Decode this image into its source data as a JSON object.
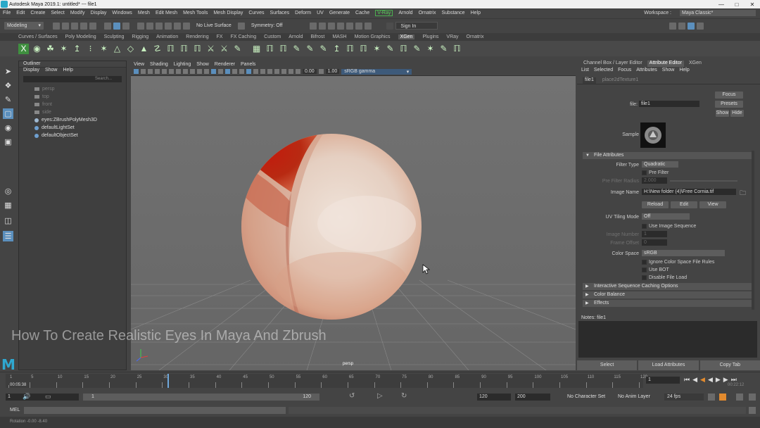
{
  "window": {
    "title": "Autodesk Maya 2019.1: untitled*   ---   file1"
  },
  "menubar": {
    "items": [
      "File",
      "Edit",
      "Create",
      "Select",
      "Modify",
      "Display",
      "Windows",
      "Mesh",
      "Edit Mesh",
      "Mesh Tools",
      "Mesh Display",
      "Curves",
      "Surfaces",
      "Deform",
      "UV",
      "Generate",
      "Cache",
      "V-Ray",
      "Arnold",
      "Ornatrix",
      "Substance",
      "Help"
    ],
    "workspace_label": "Workspace :",
    "workspace_value": "Maya Classic*"
  },
  "statusline": {
    "mode": "Modeling",
    "live_surface": "No Live Surface",
    "symmetry": "Symmetry: Off",
    "sign_in": "Sign In"
  },
  "shelf_tabs": {
    "items": [
      "Curves / Surfaces",
      "Poly Modeling",
      "Sculpting",
      "Rigging",
      "Animation",
      "Rendering",
      "FX",
      "FX Caching",
      "Custom",
      "Arnold",
      "Bifrost",
      "MASH",
      "Motion Graphics",
      "XGen",
      "Plugins",
      "VRay",
      "Ornatrix"
    ],
    "active": "XGen"
  },
  "outliner": {
    "title": "Outliner",
    "menu": [
      "Display",
      "Show",
      "Help"
    ],
    "search_placeholder": "Search...",
    "items": [
      {
        "label": "persp",
        "dim": true
      },
      {
        "label": "top",
        "dim": true
      },
      {
        "label": "front",
        "dim": true
      },
      {
        "label": "side",
        "dim": true
      },
      {
        "label": "eyes:ZBrushPolyMesh3D",
        "dim": false
      },
      {
        "label": "defaultLightSet",
        "dim": false
      },
      {
        "label": "defaultObjectSet",
        "dim": false
      }
    ]
  },
  "viewport": {
    "menu": [
      "View",
      "Shading",
      "Lighting",
      "Show",
      "Renderer",
      "Panels"
    ],
    "exposure": "0.00",
    "gamma": "1.00",
    "color_space": "sRGB gamma",
    "camera_label": "persp",
    "watermark": "How To Create Realistic Eyes In Maya And Zbrush"
  },
  "attribute_editor": {
    "tabs": [
      "Channel Box / Layer Editor",
      "Attribute Editor",
      "XGen"
    ],
    "active_tab": "Attribute Editor",
    "menu": [
      "List",
      "Selected",
      "Focus",
      "Attributes",
      "Show",
      "Help"
    ],
    "node_tabs": [
      "file1",
      "place2dTexture1"
    ],
    "node_label": "file:",
    "node_value": "file1",
    "focus_btn": "Focus",
    "presets_btn": "Presets",
    "show_btn": "Show",
    "hide_btn": "Hide",
    "sample_label": "Sample",
    "section_file_attributes": "File Attributes",
    "filter_type_label": "Filter Type",
    "filter_type_value": "Quadratic",
    "pre_filter_label": "Pre Filter",
    "pre_filter_radius_label": "Pre Filter Radius",
    "pre_filter_radius_value": "2.000",
    "image_name_label": "Image Name",
    "image_name_value": "H:\\New folder (4)\\Free Cornia.tif",
    "reload_btn": "Reload",
    "edit_btn": "Edit",
    "view_btn": "View",
    "uv_tiling_label": "UV Tiling Mode",
    "uv_tiling_value": "Off",
    "use_image_sequence": "Use Image Sequence",
    "image_number_label": "Image Number",
    "image_number_value": "1",
    "frame_offset_label": "Frame Offset",
    "frame_offset_value": "0",
    "color_space_label": "Color Space",
    "color_space_value": "sRGB",
    "ignore_cs_rules": "Ignore Color Space File Rules",
    "use_bot": "Use BOT",
    "disable_file_load": "Disable File Load",
    "section_interactive": "Interactive Sequence Caching Options",
    "section_color_balance": "Color Balance",
    "section_effects": "Effects",
    "notes_label": "Notes: file1",
    "bottom_buttons": [
      "Select",
      "Load Attributes",
      "Copy Tab"
    ]
  },
  "timeline": {
    "labels": [
      "1",
      "5",
      "10",
      "15",
      "20",
      "25",
      "30",
      "35",
      "40",
      "45",
      "50",
      "55",
      "60",
      "65",
      "70",
      "75",
      "80",
      "85",
      "90",
      "95",
      "100",
      "105",
      "110",
      "115",
      "120"
    ],
    "current_frame": "1",
    "current_frame_marker": 31,
    "elapsed": "00:05:38",
    "remaining": "00:22:12"
  },
  "range": {
    "start": "1",
    "playback_start": "1",
    "slider_start": "1",
    "slider_end": "120",
    "playback_end": "120",
    "end": "200",
    "character_set": "No Character Set",
    "anim_layer": "No Anim Layer",
    "fps": "24 fps"
  },
  "cmdline": {
    "label": "MEL"
  },
  "helpline": {
    "text": "Rotation    -0.00      -8.40"
  }
}
